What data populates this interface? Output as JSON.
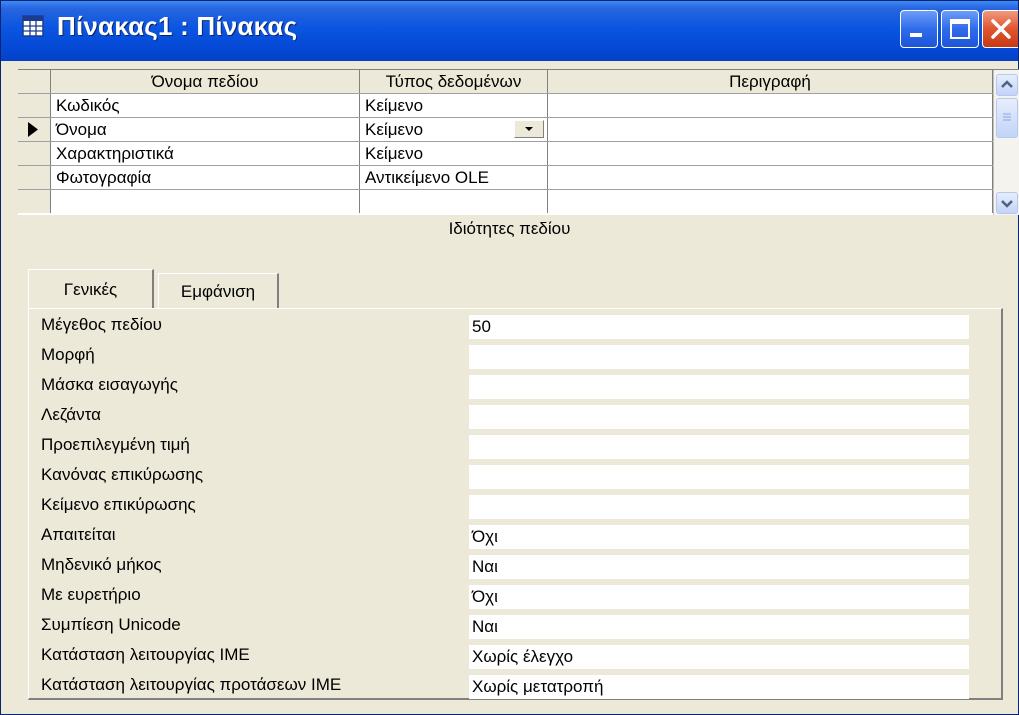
{
  "window": {
    "title": "Πίνακας1 : Πίνακας"
  },
  "grid": {
    "headers": [
      "Όνομα πεδίου",
      "Τύπος δεδομένων",
      "Περιγραφή"
    ],
    "rows": [
      {
        "name": "Κωδικός",
        "type": "Κείμενο",
        "description": ""
      },
      {
        "name": "Όνομα",
        "type": "Κείμενο",
        "description": ""
      },
      {
        "name": "Χαρακτηριστικά",
        "type": "Κείμενο",
        "description": ""
      },
      {
        "name": "Φωτογραφία",
        "type": "Αντικείμενο OLE",
        "description": ""
      }
    ]
  },
  "properties": {
    "title": "Ιδιότητες πεδίου",
    "tabs": [
      "Γενικές",
      "Εμφάνιση"
    ],
    "items": [
      {
        "label": "Μέγεθος πεδίου",
        "value": "50"
      },
      {
        "label": "Μορφή",
        "value": ""
      },
      {
        "label": "Μάσκα εισαγωγής",
        "value": ""
      },
      {
        "label": "Λεζάντα",
        "value": ""
      },
      {
        "label": "Προεπιλεγμένη τιμή",
        "value": ""
      },
      {
        "label": "Κανόνας επικύρωσης",
        "value": ""
      },
      {
        "label": "Κείμενο επικύρωσης",
        "value": ""
      },
      {
        "label": "Απαιτείται",
        "value": "Όχι"
      },
      {
        "label": "Μηδενικό μήκος",
        "value": "Ναι"
      },
      {
        "label": "Με ευρετήριο",
        "value": "Όχι"
      },
      {
        "label": "Συμπίεση Unicode",
        "value": "Ναι"
      },
      {
        "label": "Κατάσταση λειτουργίας IME",
        "value": "Χωρίς έλεγχο"
      },
      {
        "label": "Κατάσταση λειτουργίας προτάσεων IME",
        "value": "Χωρίς μετατροπή"
      }
    ]
  }
}
